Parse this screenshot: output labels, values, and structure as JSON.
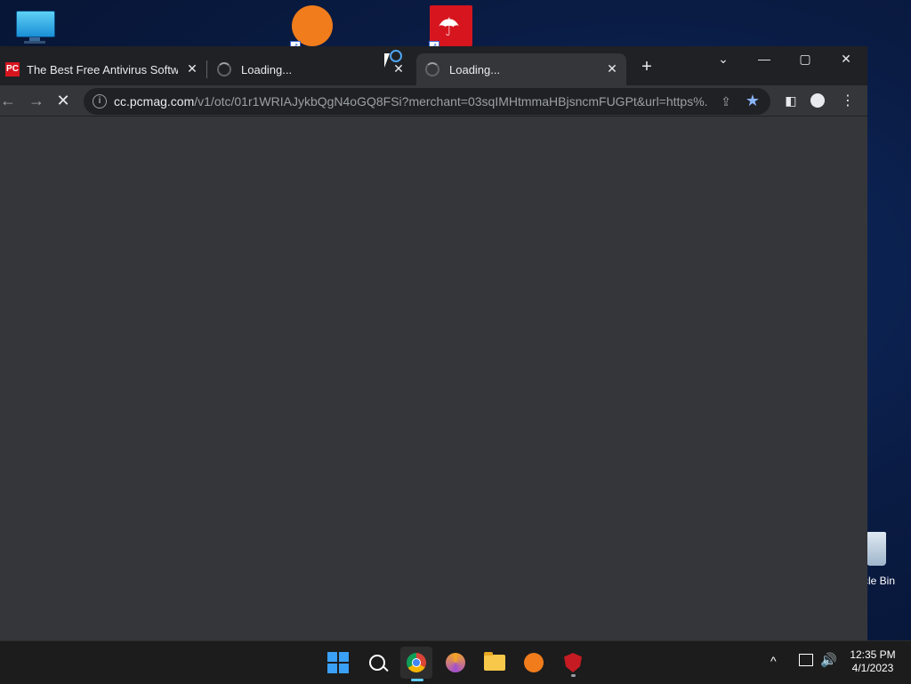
{
  "desktop": {
    "recycle_bin_label": "cle Bin"
  },
  "browser": {
    "tabs": [
      {
        "favicon": "PC",
        "title": "The Best Free Antivirus Software",
        "close": "✕"
      },
      {
        "title": "Loading...",
        "close": "✕"
      },
      {
        "title": "Loading...",
        "close": "✕"
      }
    ],
    "new_tab": "+",
    "window_controls": {
      "tab_search": "⌄",
      "minimize": "—",
      "maximize": "▢",
      "close": "✕"
    },
    "toolbar": {
      "back": "←",
      "forward": "→",
      "stop": "✕",
      "url_host": "cc.pcmag.com",
      "url_rest": "/v1/otc/01r1WRIAJykbQgN4oGQ8FSi?merchant=03sqIMHtmmaHBjsncmFUGPt&url=https%...",
      "info": "i",
      "share": "⇪",
      "star": "★",
      "side_panel": "◧",
      "menu": "⋮"
    }
  },
  "taskbar": {
    "tray_chevron": "^",
    "volume": "🔊",
    "time": "12:35 PM",
    "date": "4/1/2023"
  },
  "colors": {
    "accent": "#8ab4f8",
    "tabstrip_bg": "#202124",
    "toolbar_bg": "#35363a"
  }
}
